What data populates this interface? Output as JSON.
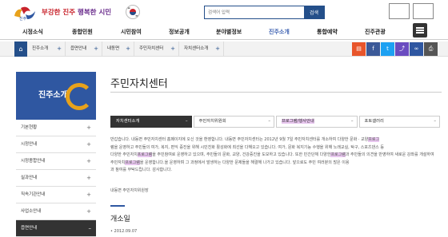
{
  "header": {
    "slogan_part1": "부강한 진주",
    "slogan_part2": "행복한 시민",
    "logo_text": "진주",
    "search": {
      "placeholder": "검색어 입력",
      "button": "검색"
    }
  },
  "nav": [
    "시정소식",
    "종합민원",
    "시민참여",
    "정보공개",
    "분야별정보",
    "진주소개",
    "통합예약",
    "진주관광"
  ],
  "nav_active": "진주소개",
  "breadcrumb": [
    "진주소개",
    "읍면안내",
    "내동면",
    "주민자치센터",
    "자치센터소개"
  ],
  "colors": {
    "primary": "#244f8a",
    "accent": "#c8232c",
    "highlight": "#e8c6ef",
    "share_colors": [
      "#e8552b",
      "#3b5998",
      "#1da1f2",
      "#6a4cc0",
      "#2f57a1",
      "#555555"
    ]
  },
  "sidebar": {
    "title": "진주소개",
    "items": [
      "기본현황",
      "시정안내",
      "시정종합안내",
      "실과안내",
      "직속기관안내",
      "사업소안내",
      "읍면안내"
    ],
    "active": "읍면안내"
  },
  "page": {
    "title": "주민자치센터",
    "tabs": [
      "자치센터소개",
      "주민자치위원회",
      "프로그램/행사안내",
      "포토갤러리"
    ],
    "active_tab": "자치센터소개",
    "para_1": "반갑습니다. 내동면 주민자치센터 홈페이지에 오신 것을 환영합니다. 내동면 주민자치센터는 2012년 9월 7일 주민자치센터를 개소하여 다양한 문화 · 교양",
    "para_2_a": "프로그",
    "para_2_b": "램을 운영하고 주민들의 여가, 복지, 편익 증진을 위해 시민친화 활성화에 최선을 다해오고 있습니다. 여가, 문화 복지기능 수행을 위해 노래교실, 탁구, 스포츠댄스 등",
    "para_3_a": "다양한 주민자치",
    "para_3_b": "프로그램",
    "para_3_c": "을 주민참여로 운영하고 있으며, 주민들의 문화, 교양, 건강증진을 도모하고 있습니다. 또한 민간단체 다양한",
    "para_3_d": "프로그램",
    "para_3_e": "과 주민들의 의견을 반영하여 새로운 강좌를 개설하여",
    "para_4_a": "주민자치",
    "para_4_b": "프로그램",
    "para_4_c": "을 운영합니다.",
    "para_5_a": "을 운영하며 그 과정에서 발생하는 다양한 문제들을 해결해 나가고 있습니다. 앞으로도 주민 여러분의 많은 이용",
    "para_5_b": "과 참여를 부탁드립니다. 감사합니다.",
    "signature": "내동면 주민자치위원장",
    "subtitle": "개소일",
    "date": "2012.09.07"
  }
}
